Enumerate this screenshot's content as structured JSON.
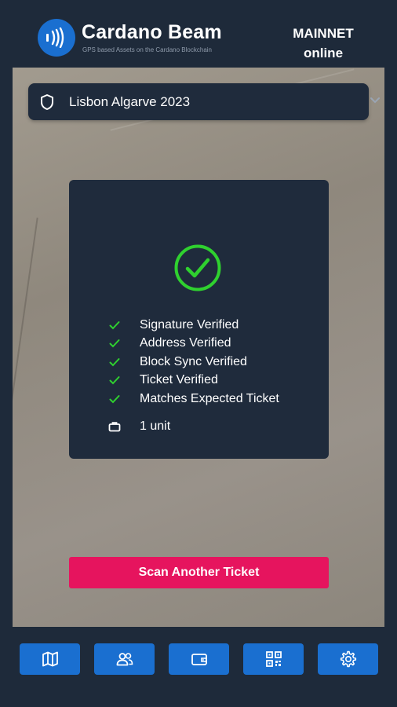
{
  "header": {
    "app_name": "Cardano Beam",
    "tagline": "GPS based Assets on the Cardano Blockchain",
    "network": "MAINNET",
    "status": "online"
  },
  "event_select": {
    "selected": "Lisbon Algarve 2023"
  },
  "verification": {
    "checks": [
      "Signature Verified",
      "Address Verified",
      "Block Sync Verified",
      "Ticket Verified",
      "Matches Expected Ticket"
    ],
    "units": "1 unit"
  },
  "actions": {
    "scan_again": "Scan Another Ticket"
  },
  "nav": [
    {
      "icon": "map-icon"
    },
    {
      "icon": "users-icon"
    },
    {
      "icon": "wallet-icon"
    },
    {
      "icon": "qr-code-icon"
    },
    {
      "icon": "gear-icon"
    }
  ],
  "colors": {
    "background": "#1e2a3a",
    "card": "#1f2b3c",
    "accent_blue": "#1a6fd0",
    "success_green": "#2fd12f",
    "primary_pink": "#e6145e"
  }
}
